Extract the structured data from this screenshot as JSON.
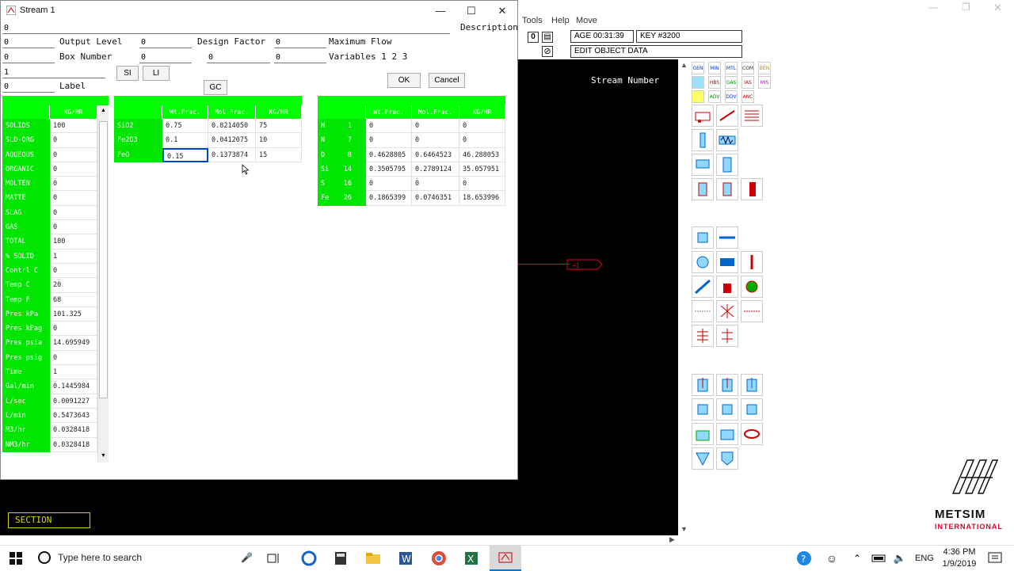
{
  "window": {
    "title": "Stream 1",
    "description_label": "Description"
  },
  "app": {
    "menu": [
      "Tools",
      "Help",
      "Move"
    ],
    "age": "AGE 00:31:39",
    "key": "KEY #3200",
    "edit_label": "EDIT OBJECT DATA",
    "stream_number_label": "Stream Number",
    "section_label": "SECTION",
    "palette_tags": [
      "GEN",
      "MIN",
      "MTL",
      "COM",
      "BEN",
      "",
      "HBS",
      "GAS",
      "IAS",
      "MIS",
      "",
      "ADV",
      "DDV",
      "ANC"
    ]
  },
  "form": {
    "top_field": "0",
    "output_level_label": "Output Level",
    "box_number_label": "Box Number",
    "design_factor_label": "Design Factor",
    "maximum_flow_label": "Maximum Flow",
    "variables_label": "Variables 1 2 3",
    "label_label": "Label",
    "fields": {
      "f1": "0",
      "f2": "0",
      "f3": "0",
      "f4": "0",
      "f5": "0",
      "f6": "0",
      "f7": "0",
      "f8": "1",
      "f9": "0"
    },
    "si_button": "SI",
    "li_button": "LI",
    "gc_button": "GC",
    "ok_button": "OK",
    "cancel_button": "Cancel"
  },
  "phase_grid": {
    "header": "KG/HR",
    "rows": [
      {
        "label": "SOLIDS",
        "value": "100"
      },
      {
        "label": "SLD-ORG",
        "value": "0"
      },
      {
        "label": "AQUEOUS",
        "value": "0"
      },
      {
        "label": "ORGANIC",
        "value": "0"
      },
      {
        "label": "MOLTEN",
        "value": "0"
      },
      {
        "label": "MATTE",
        "value": "0"
      },
      {
        "label": "SLAG",
        "value": "0"
      },
      {
        "label": "GAS",
        "value": "0"
      },
      {
        "label": "TOTAL",
        "value": "100"
      },
      {
        "label": "% SOLID",
        "value": "1"
      },
      {
        "label": "Contrl C",
        "value": "0"
      },
      {
        "label": "Temp C",
        "value": "20"
      },
      {
        "label": "Temp F",
        "value": "68"
      },
      {
        "label": "Pres kPa",
        "value": "101.325"
      },
      {
        "label": "Pres kPag",
        "value": "0"
      },
      {
        "label": "Pres psia",
        "value": "14.695949"
      },
      {
        "label": "Pres psig",
        "value": "0"
      },
      {
        "label": "Time",
        "value": "1"
      },
      {
        "label": "Gal/min",
        "value": "0.1445984"
      },
      {
        "label": "L/sec",
        "value": "0.0091227"
      },
      {
        "label": "L/min",
        "value": "0.5473643"
      },
      {
        "label": "M3/hr",
        "value": "0.0328418"
      },
      {
        "label": "NM3/hr",
        "value": "0.0328418"
      }
    ]
  },
  "component_grid": {
    "headers": [
      "Wt.Frac.",
      "Mol.Frac.",
      "KG/HR"
    ],
    "rows": [
      {
        "label": "SiO2",
        "wt": "0.75",
        "mol": "0.8214050",
        "kg": "75"
      },
      {
        "label": "Fe2O3",
        "wt": "0.1",
        "mol": "0.0412075",
        "kg": "10"
      },
      {
        "label": "FeO",
        "wt": "0.15",
        "mol": "0.1373874",
        "kg": "15"
      }
    ]
  },
  "element_grid": {
    "headers": [
      "Wt.Frac.",
      "Mol.Frac.",
      "KG/HR"
    ],
    "rows": [
      {
        "label": "H",
        "num": "1",
        "wt": "0",
        "mol": "0",
        "kg": "0"
      },
      {
        "label": "N",
        "num": "7",
        "wt": "0",
        "mol": "0",
        "kg": "0"
      },
      {
        "label": "O",
        "num": "8",
        "wt": "0.4628805",
        "mol": "0.6464523",
        "kg": "46.288053"
      },
      {
        "label": "Si",
        "num": "14",
        "wt": "0.3505795",
        "mol": "0.2789124",
        "kg": "35.057951"
      },
      {
        "label": "S",
        "num": "16",
        "wt": "0",
        "mol": "0",
        "kg": "0"
      },
      {
        "label": "Fe",
        "num": "26",
        "wt": "0.1865399",
        "mol": "0.0746351",
        "kg": "18.653996"
      }
    ]
  },
  "logo": {
    "line1": "METSIM",
    "line2": "INTERNATIONAL"
  },
  "taskbar": {
    "search_placeholder": "Type here to search",
    "lang": "ENG",
    "time": "4:36 PM",
    "date": "1/9/2019"
  },
  "colors": {
    "grid_green": "#00ff00",
    "accent_red": "#e0002a"
  }
}
